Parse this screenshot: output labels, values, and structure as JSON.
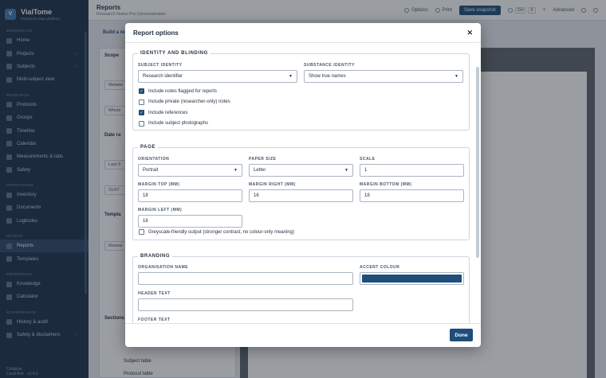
{
  "app": {
    "name": "VialTome",
    "tagline": "Research notes platform"
  },
  "sidebar": {
    "sections": [
      {
        "title": "WORKSPACE",
        "items": [
          {
            "label": "Home",
            "icon": "home-icon"
          },
          {
            "label": "Projects",
            "icon": "folder-icon",
            "chevron": "›"
          },
          {
            "label": "Subjects",
            "icon": "user-icon",
            "chevron": "›"
          },
          {
            "label": "Multi-subject view",
            "icon": "grid-icon"
          }
        ]
      },
      {
        "title": "RESEARCH",
        "items": [
          {
            "label": "Protocols",
            "icon": "clipboard-icon"
          },
          {
            "label": "Groups",
            "icon": "users-icon"
          },
          {
            "label": "Timeline",
            "icon": "timeline-icon"
          },
          {
            "label": "Calendar",
            "icon": "calendar-icon"
          },
          {
            "label": "Measurements & labs",
            "icon": "flask-icon"
          },
          {
            "label": "Safety",
            "icon": "shield-icon"
          }
        ]
      },
      {
        "title": "OPERATIONS",
        "items": [
          {
            "label": "Inventory",
            "icon": "box-icon"
          },
          {
            "label": "Documents",
            "icon": "document-icon"
          },
          {
            "label": "Logbooks",
            "icon": "book-icon"
          }
        ]
      },
      {
        "title": "OUTPUT",
        "items": [
          {
            "label": "Reports",
            "icon": "report-icon",
            "active": true
          },
          {
            "label": "Templates",
            "icon": "template-icon"
          }
        ]
      },
      {
        "title": "REFERENCE",
        "items": [
          {
            "label": "Knowledge",
            "icon": "lightbulb-icon"
          },
          {
            "label": "Calculator",
            "icon": "calculator-icon"
          }
        ]
      },
      {
        "title": "GOVERNANCE",
        "items": [
          {
            "label": "History & audit",
            "icon": "history-icon"
          },
          {
            "label": "Safety & disclaimers",
            "icon": "warning-icon",
            "chevron": "›"
          }
        ]
      }
    ],
    "collapse_label": "Collapse",
    "version": "Local-first · v1.4.0"
  },
  "topbar": {
    "title": "Reports",
    "subtitle": "Research Notes Pro Demonstration",
    "options_label": "Options",
    "print_label": "Print",
    "snapshot_label": "Save snapshot",
    "search_shortcut": "Ctrl",
    "search_key": "K",
    "advanced_label": "Advanced"
  },
  "background": {
    "tab_label": "Build a re",
    "scope_title": "Scope",
    "project_value": "Metabo",
    "report_value": "Whole",
    "date_title": "Date ra",
    "date_value": "Last 9",
    "from_value": "01/07",
    "template_title": "Templa",
    "template_value": "Resear",
    "sections_title": "Sections",
    "row1": "Subject table",
    "row2": "Protocol table"
  },
  "modal": {
    "title": "Report options",
    "close_glyph": "✕",
    "identity": {
      "legend": "IDENTITY AND BLINDING",
      "subject_identity_label": "Subject identity",
      "subject_identity_value": "Research identifier",
      "substance_identity_label": "Substance identity",
      "substance_identity_value": "Show true names",
      "checks": [
        {
          "label": "Include notes flagged for reports",
          "checked": true
        },
        {
          "label": "Include private (researcher-only) notes",
          "checked": false
        },
        {
          "label": "Include references",
          "checked": true
        },
        {
          "label": "Include subject photographs",
          "checked": false
        }
      ]
    },
    "page": {
      "legend": "PAGE",
      "orientation_label": "Orientation",
      "orientation_value": "Portrait",
      "paper_label": "Paper size",
      "paper_value": "Letter",
      "scale_label": "Scale",
      "scale_value": "1",
      "margin_top_label": "Margin top (mm)",
      "margin_top_value": "18",
      "margin_right_label": "Margin right (mm)",
      "margin_right_value": "16",
      "margin_bottom_label": "Margin bottom (mm)",
      "margin_bottom_value": "18",
      "margin_left_label": "Margin left (mm)",
      "margin_left_value": "16",
      "greyscale_label": "Greyscale-friendly output (stronger contrast, no colour-only meaning)",
      "greyscale_checked": false
    },
    "branding": {
      "legend": "BRANDING",
      "org_label": "Organisation name",
      "org_value": "",
      "accent_label": "Accent colour",
      "accent_color": "#1e4e79",
      "header_label": "Header text",
      "header_value": "",
      "footer_label": "Footer text",
      "footer_value": ""
    },
    "done_label": "Done"
  }
}
